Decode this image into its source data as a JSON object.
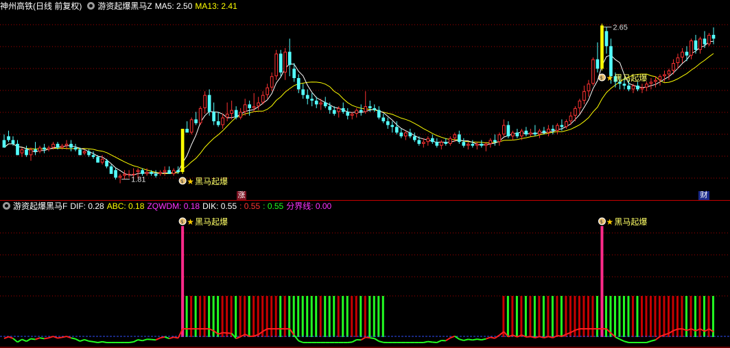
{
  "main_header": {
    "stock_name": "神州高铁",
    "period": "(日线 前复权)",
    "indicator_name": "游资起爆黑马Z",
    "ma5_label": "MA5: 2.50",
    "ma13_label": "MA13: 2.41"
  },
  "sub_header": {
    "indicator_name": "游资起爆黑马F",
    "dif_label": "DIF: 0.28",
    "abc_label": "ABC: 0.18",
    "zqwdm_label": "ZQWDM: 0.18",
    "dik_label": "DIK: 0.55",
    "dik_red": ": 0.55",
    "dik_green": ": 0.55",
    "boundary_label": "分界线: 0.00"
  },
  "badges": {
    "zhang": "涨",
    "cai": "财"
  },
  "signal_text": "黑马起爆",
  "colors": {
    "up": "#ff3232",
    "down": "#54ffff",
    "signal_bar": "#ffff00",
    "ma5": "#ffffff",
    "ma13": "#ffff00",
    "osc_red": "#c80000",
    "osc_green": "#22ff22",
    "pink": "#ff2a8a",
    "grid": "#b00000",
    "gold_text": "#ffff66",
    "header_label": "#ffffff",
    "magenta": "#ff33ff"
  },
  "chart_data": {
    "type": "candlestick",
    "price_range": [
      1.75,
      2.72
    ],
    "labels": {
      "high": "2.65",
      "low": "1.81"
    },
    "annotations": [
      {
        "index": 40,
        "text": "黑马起爆"
      },
      {
        "index": 134,
        "text": "黑马起爆"
      }
    ],
    "candles": [
      [
        2.04,
        2.07,
        2.02,
        2.0
      ],
      [
        2.06,
        2.09,
        2.03,
        2.04
      ],
      [
        2.04,
        2.06,
        2.01,
        2.02
      ],
      [
        2.02,
        2.04,
        1.96,
        1.96
      ],
      [
        1.97,
        2.0,
        1.95,
        1.99
      ],
      [
        1.99,
        2.01,
        1.95,
        1.96
      ],
      [
        1.96,
        2.0,
        1.93,
        1.99
      ],
      [
        1.99,
        2.03,
        1.96,
        1.98
      ],
      [
        1.98,
        2.01,
        1.97,
        2.0
      ],
      [
        2.0,
        2.02,
        1.97,
        1.99
      ],
      [
        1.99,
        2.01,
        1.98,
        2.0
      ],
      [
        2.0,
        2.03,
        1.99,
        2.02
      ],
      [
        2.02,
        2.03,
        1.99,
        2.0
      ],
      [
        2.0,
        2.02,
        1.99,
        2.01
      ],
      [
        2.01,
        2.04,
        1.99,
        2.02
      ],
      [
        2.02,
        2.04,
        1.98,
        2.0
      ],
      [
        2.0,
        2.02,
        1.98,
        1.99
      ],
      [
        1.99,
        2.0,
        1.96,
        1.96
      ],
      [
        1.97,
        1.99,
        1.96,
        1.98
      ],
      [
        1.98,
        1.99,
        1.95,
        1.96
      ],
      [
        1.96,
        1.98,
        1.94,
        1.95
      ],
      [
        1.95,
        1.96,
        1.92,
        1.92
      ],
      [
        1.92,
        1.96,
        1.91,
        1.94
      ],
      [
        1.93,
        1.94,
        1.89,
        1.9
      ],
      [
        1.9,
        1.91,
        1.86,
        1.86
      ],
      [
        1.88,
        1.89,
        1.83,
        1.84
      ],
      [
        1.84,
        1.86,
        1.81,
        1.85
      ],
      [
        1.85,
        1.88,
        1.83,
        1.86
      ],
      [
        1.86,
        1.88,
        1.84,
        1.86
      ],
      [
        1.86,
        1.89,
        1.84,
        1.86
      ],
      [
        1.87,
        1.89,
        1.84,
        1.88
      ],
      [
        1.88,
        1.89,
        1.85,
        1.86
      ],
      [
        1.86,
        1.89,
        1.85,
        1.87
      ],
      [
        1.87,
        1.88,
        1.85,
        1.86
      ],
      [
        1.86,
        1.88,
        1.84,
        1.85
      ],
      [
        1.86,
        1.88,
        1.85,
        1.87
      ],
      [
        1.87,
        1.9,
        1.85,
        1.88
      ],
      [
        1.88,
        1.9,
        1.86,
        1.86
      ],
      [
        1.86,
        1.89,
        1.85,
        1.88
      ],
      [
        1.88,
        1.9,
        1.86,
        1.87
      ],
      [
        1.87,
        2.1,
        1.86,
        2.1
      ],
      [
        2.1,
        2.14,
        2.08,
        2.08
      ],
      [
        2.08,
        2.16,
        2.07,
        2.15
      ],
      [
        2.15,
        2.19,
        2.12,
        2.13
      ],
      [
        2.13,
        2.22,
        2.12,
        2.21
      ],
      [
        2.21,
        2.3,
        2.18,
        2.28
      ],
      [
        2.28,
        2.31,
        2.17,
        2.19
      ],
      [
        2.19,
        2.24,
        2.12,
        2.14
      ],
      [
        2.14,
        2.19,
        2.11,
        2.12
      ],
      [
        2.12,
        2.18,
        2.1,
        2.16
      ],
      [
        2.16,
        2.24,
        2.14,
        2.18
      ],
      [
        2.18,
        2.25,
        2.15,
        2.2
      ],
      [
        2.2,
        2.22,
        2.15,
        2.16
      ],
      [
        2.16,
        2.21,
        2.15,
        2.19
      ],
      [
        2.19,
        2.26,
        2.17,
        2.23
      ],
      [
        2.23,
        2.25,
        2.17,
        2.21
      ],
      [
        2.21,
        2.29,
        2.19,
        2.22
      ],
      [
        2.22,
        2.27,
        2.2,
        2.24
      ],
      [
        2.24,
        2.3,
        2.23,
        2.28
      ],
      [
        2.28,
        2.34,
        2.26,
        2.32
      ],
      [
        2.32,
        2.4,
        2.3,
        2.38
      ],
      [
        2.38,
        2.52,
        2.36,
        2.5
      ],
      [
        2.5,
        2.52,
        2.38,
        2.4
      ],
      [
        2.4,
        2.53,
        2.36,
        2.51
      ],
      [
        2.51,
        2.58,
        2.38,
        2.44
      ],
      [
        2.42,
        2.45,
        2.35,
        2.37
      ],
      [
        2.37,
        2.39,
        2.29,
        2.31
      ],
      [
        2.31,
        2.34,
        2.26,
        2.28
      ],
      [
        2.28,
        2.31,
        2.23,
        2.26
      ],
      [
        2.26,
        2.29,
        2.22,
        2.25
      ],
      [
        2.25,
        2.27,
        2.21,
        2.23
      ],
      [
        2.23,
        2.26,
        2.2,
        2.24
      ],
      [
        2.24,
        2.27,
        2.21,
        2.22
      ],
      [
        2.22,
        2.24,
        2.18,
        2.2
      ],
      [
        2.2,
        2.22,
        2.17,
        2.18
      ],
      [
        2.19,
        2.22,
        2.16,
        2.21
      ],
      [
        2.21,
        2.24,
        2.18,
        2.19
      ],
      [
        2.19,
        2.21,
        2.15,
        2.17
      ],
      [
        2.17,
        2.19,
        2.15,
        2.18
      ],
      [
        2.18,
        2.21,
        2.16,
        2.2
      ],
      [
        2.2,
        2.23,
        2.17,
        2.19
      ],
      [
        2.19,
        2.3,
        2.18,
        2.22
      ],
      [
        2.22,
        2.25,
        2.19,
        2.21
      ],
      [
        2.21,
        2.23,
        2.19,
        2.2
      ],
      [
        2.2,
        2.22,
        2.15,
        2.16
      ],
      [
        2.16,
        2.18,
        2.13,
        2.14
      ],
      [
        2.14,
        2.16,
        2.1,
        2.12
      ],
      [
        2.12,
        2.14,
        2.08,
        2.11
      ],
      [
        2.11,
        2.14,
        2.07,
        2.08
      ],
      [
        2.08,
        2.1,
        2.05,
        2.06
      ],
      [
        2.06,
        2.09,
        2.04,
        2.08
      ],
      [
        2.08,
        2.1,
        2.05,
        2.06
      ],
      [
        2.06,
        2.08,
        2.03,
        2.04
      ],
      [
        2.04,
        2.06,
        2.01,
        2.02
      ],
      [
        2.02,
        2.05,
        2.0,
        2.03
      ],
      [
        2.03,
        2.06,
        2.01,
        2.05
      ],
      [
        2.05,
        2.07,
        2.02,
        2.03
      ],
      [
        2.03,
        2.05,
        2.0,
        2.01
      ],
      [
        2.01,
        2.04,
        1.99,
        2.03
      ],
      [
        2.03,
        2.05,
        2.01,
        2.02
      ],
      [
        2.02,
        2.06,
        2.01,
        2.05
      ],
      [
        2.05,
        2.08,
        2.03,
        2.07
      ],
      [
        2.07,
        2.09,
        2.02,
        2.03
      ],
      [
        2.03,
        2.05,
        2.0,
        2.01
      ],
      [
        2.01,
        2.03,
        1.99,
        2.02
      ],
      [
        2.02,
        2.04,
        2.0,
        2.01
      ],
      [
        2.01,
        2.03,
        1.99,
        2.02
      ],
      [
        2.02,
        2.04,
        2.0,
        2.01
      ],
      [
        2.01,
        2.03,
        1.98,
        2.02
      ],
      [
        2.02,
        2.05,
        2.0,
        2.04
      ],
      [
        2.04,
        2.07,
        2.01,
        2.03
      ],
      [
        2.03,
        2.08,
        2.01,
        2.07
      ],
      [
        2.07,
        2.15,
        2.06,
        2.12
      ],
      [
        2.12,
        2.14,
        2.05,
        2.06
      ],
      [
        2.06,
        2.09,
        2.04,
        2.08
      ],
      [
        2.08,
        2.1,
        2.05,
        2.06
      ],
      [
        2.06,
        2.1,
        2.04,
        2.09
      ],
      [
        2.09,
        2.11,
        2.06,
        2.07
      ],
      [
        2.07,
        2.1,
        2.06,
        2.08
      ],
      [
        2.08,
        2.12,
        2.06,
        2.07
      ],
      [
        2.07,
        2.1,
        2.05,
        2.09
      ],
      [
        2.09,
        2.11,
        2.07,
        2.08
      ],
      [
        2.08,
        2.12,
        2.06,
        2.1
      ],
      [
        2.1,
        2.12,
        2.07,
        2.09
      ],
      [
        2.09,
        2.13,
        2.07,
        2.12
      ],
      [
        2.12,
        2.15,
        2.09,
        2.11
      ],
      [
        2.11,
        2.15,
        2.1,
        2.14
      ],
      [
        2.14,
        2.19,
        2.12,
        2.17
      ],
      [
        2.17,
        2.22,
        2.14,
        2.21
      ],
      [
        2.21,
        2.26,
        2.18,
        2.25
      ],
      [
        2.25,
        2.33,
        2.23,
        2.3
      ],
      [
        2.3,
        2.36,
        2.27,
        2.34
      ],
      [
        2.34,
        2.48,
        2.33,
        2.47
      ],
      [
        2.47,
        2.56,
        2.4,
        2.42
      ],
      [
        2.42,
        2.66,
        2.41,
        2.65
      ],
      [
        2.62,
        2.64,
        2.5,
        2.54
      ],
      [
        2.54,
        2.58,
        2.34,
        2.38
      ],
      [
        2.38,
        2.4,
        2.32,
        2.35
      ],
      [
        2.35,
        2.38,
        2.31,
        2.34
      ],
      [
        2.34,
        2.37,
        2.31,
        2.33
      ],
      [
        2.33,
        2.36,
        2.3,
        2.31
      ],
      [
        2.31,
        2.34,
        2.29,
        2.33
      ],
      [
        2.33,
        2.35,
        2.3,
        2.31
      ],
      [
        2.31,
        2.34,
        2.29,
        2.32
      ],
      [
        2.32,
        2.35,
        2.3,
        2.34
      ],
      [
        2.34,
        2.37,
        2.31,
        2.35
      ],
      [
        2.35,
        2.38,
        2.32,
        2.36
      ],
      [
        2.36,
        2.39,
        2.33,
        2.38
      ],
      [
        2.38,
        2.41,
        2.35,
        2.39
      ],
      [
        2.39,
        2.42,
        2.36,
        2.41
      ],
      [
        2.41,
        2.47,
        2.39,
        2.45
      ],
      [
        2.45,
        2.5,
        2.42,
        2.48
      ],
      [
        2.48,
        2.53,
        2.45,
        2.51
      ],
      [
        2.51,
        2.54,
        2.46,
        2.49
      ],
      [
        2.49,
        2.58,
        2.47,
        2.57
      ],
      [
        2.57,
        2.6,
        2.5,
        2.52
      ],
      [
        2.52,
        2.59,
        2.5,
        2.58
      ],
      [
        2.58,
        2.62,
        2.53,
        2.55
      ],
      [
        2.55,
        2.61,
        2.54,
        2.6
      ],
      [
        2.6,
        2.64,
        2.55,
        2.58
      ]
    ],
    "oscillator": {
      "boundary": 0.0,
      "dif_label_value": 0.28,
      "bar_pattern": "red/green columns alternate from signal bars onward"
    }
  }
}
